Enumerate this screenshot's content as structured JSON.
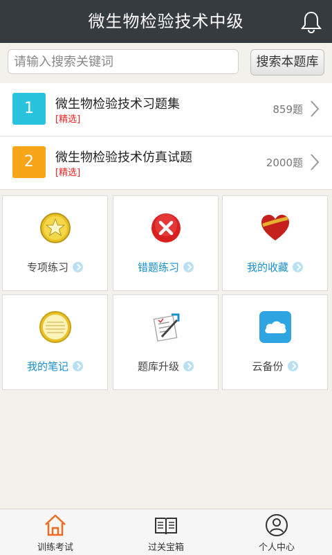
{
  "header": {
    "title": "微生物检验技术中级",
    "bell_icon": "bell-icon"
  },
  "search": {
    "placeholder": "请输入搜索关键词",
    "value": "",
    "button_label": "搜索本题库"
  },
  "question_sets": [
    {
      "index": "1",
      "name": "微生物检验技术习题集",
      "tag": "[精选]",
      "count": "859题",
      "color": "#29c3dd"
    },
    {
      "index": "2",
      "name": "微生物检验技术仿真试题",
      "tag": "[精选]",
      "count": "2000题",
      "color": "#f7a61a"
    }
  ],
  "tiles": [
    {
      "label": "专项练习",
      "icon": "star-medal-icon",
      "label_color": "#444444"
    },
    {
      "label": "错题练习",
      "icon": "red-x-icon",
      "label_color": "#1a8fd0"
    },
    {
      "label": "我的收藏",
      "icon": "heart-icon",
      "label_color": "#1a8fd0"
    },
    {
      "label": "我的笔记",
      "icon": "notepad-icon",
      "label_color": "#1a8fd0"
    },
    {
      "label": "题库升级",
      "icon": "document-edit-icon",
      "label_color": "#444444"
    },
    {
      "label": "云备份",
      "icon": "cloud-icon",
      "label_color": "#444444"
    }
  ],
  "bottom_nav": [
    {
      "label": "训练考试",
      "icon": "home-icon",
      "active": true
    },
    {
      "label": "过关宝箱",
      "icon": "book-icon",
      "active": false
    },
    {
      "label": "个人中心",
      "icon": "user-icon",
      "active": false
    }
  ],
  "colors": {
    "header_bg": "#363b3f",
    "accent_blue": "#1a8fd0",
    "accent_orange": "#f06a1e",
    "tag_red": "#ee2222"
  }
}
